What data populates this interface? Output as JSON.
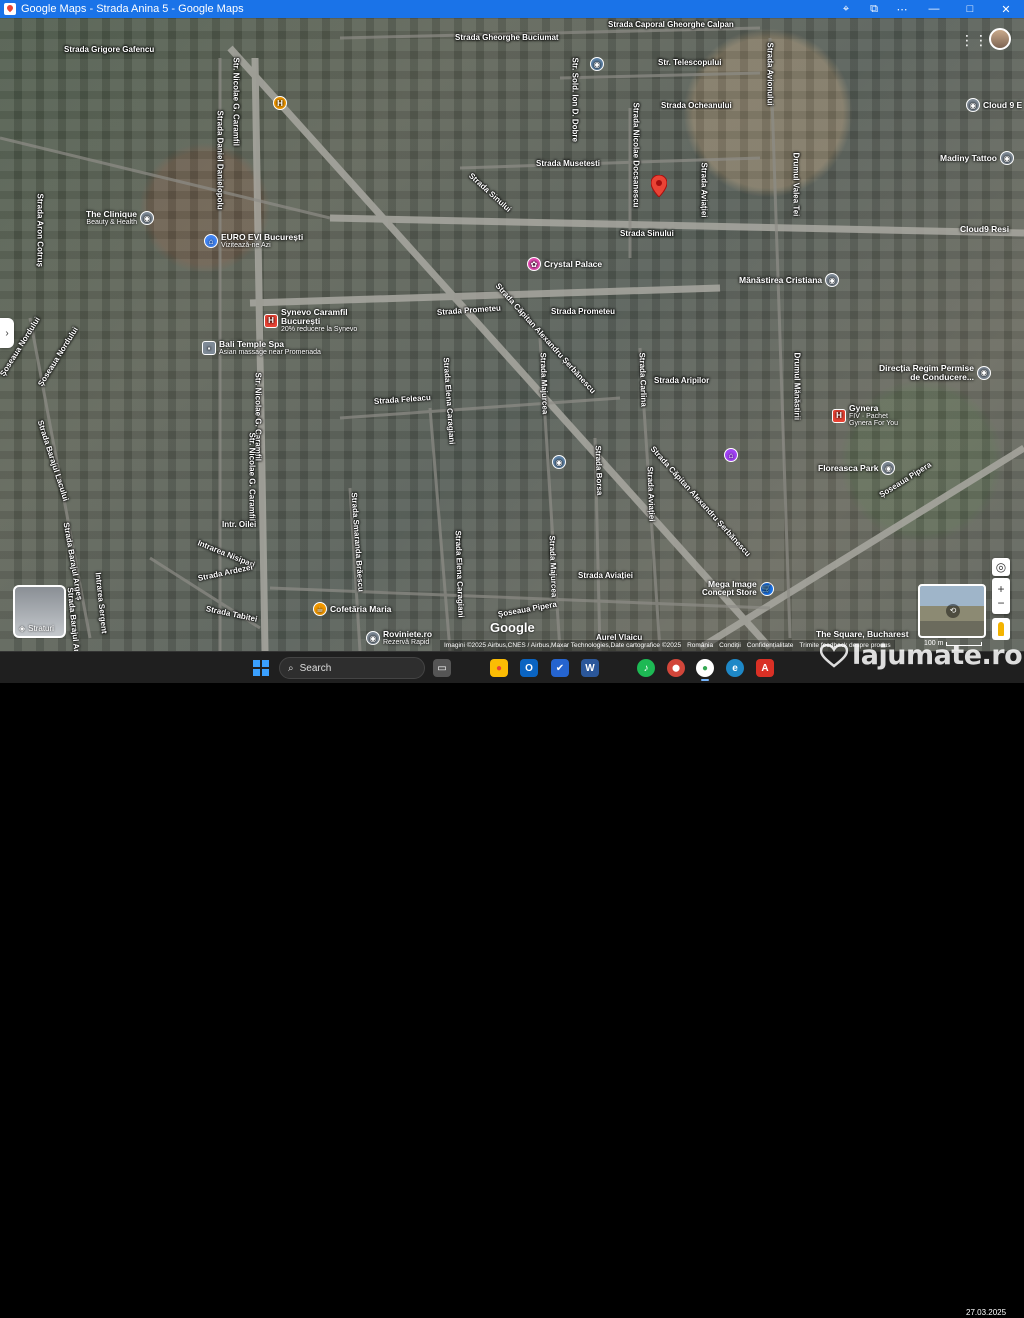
{
  "window": {
    "title": "Google Maps - Strada Anina 5 - Google Maps",
    "controls": {
      "minimize": "—",
      "maximize": "□",
      "close": "✕"
    }
  },
  "toolbar_icons": [
    "location-icon",
    "extension-icon",
    "more-icon"
  ],
  "streets": [
    {
      "id": "grigore-gafencu",
      "label": "Strada Grigore Gafencu"
    },
    {
      "id": "gheorghe-buciumat",
      "label": "Strada Gheorghe Buciumat"
    },
    {
      "id": "caporal-calpan",
      "label": "Strada Caporal Gheorghe Calpan"
    },
    {
      "id": "telescopului",
      "label": "Str. Telescopului"
    },
    {
      "id": "ocheanului",
      "label": "Strada Ocheanului"
    },
    {
      "id": "musetesti",
      "label": "Strada Musetesti"
    },
    {
      "id": "sinului-1",
      "label": "Strada Sinului"
    },
    {
      "id": "sinului-2",
      "label": "Strada Sinului"
    },
    {
      "id": "nicolae-caramfil-1",
      "label": "Str. Nicolae G. Caramfil"
    },
    {
      "id": "daniel-danielopolu",
      "label": "Strada Daniel Danielopolu"
    },
    {
      "id": "aron-cotrus",
      "label": "Strada Aron Cotruș"
    },
    {
      "id": "sold-ion-dobre",
      "label": "Str. Sold. Ion D. Dobre"
    },
    {
      "id": "nicolae-docsanescu",
      "label": "Strada Nicolae Docsanescu"
    },
    {
      "id": "avionului",
      "label": "Strada Avionului"
    },
    {
      "id": "aviatiei-1",
      "label": "Strada Aviației"
    },
    {
      "id": "drumul-valea-1",
      "label": "Drumul Valea Tei"
    },
    {
      "id": "prometeu-1",
      "label": "Strada Prometeu"
    },
    {
      "id": "prometeu-2",
      "label": "Strada Prometeu"
    },
    {
      "id": "serbanescu-1",
      "label": "Strada Căpitan Alexandru Șerbănescu"
    },
    {
      "id": "serbanescu-2",
      "label": "Strada Căpitan Alexandru Șerbănescu"
    },
    {
      "id": "majurcea-1",
      "label": "Strada Majurcea"
    },
    {
      "id": "majurcea-2",
      "label": "Strada Majurcea"
    },
    {
      "id": "elena-caragiani-1",
      "label": "Strada Elena Caragiani"
    },
    {
      "id": "elena-caragiani-2",
      "label": "Strada Elena Caragiani"
    },
    {
      "id": "feleacu",
      "label": "Strada Feleacu"
    },
    {
      "id": "aripilor",
      "label": "Strada Aripilor"
    },
    {
      "id": "carlina",
      "label": "Strada Carlina"
    },
    {
      "id": "borsa",
      "label": "Strada Borsa"
    },
    {
      "id": "aviatiei-2",
      "label": "Strada Aviației"
    },
    {
      "id": "aviatiei-3",
      "label": "Strada Aviației"
    },
    {
      "id": "smaranda-braescu",
      "label": "Strada Smaranda Brăescu"
    },
    {
      "id": "nicolae-caramfil-2",
      "label": "Str. Nicolae G. Caramfil"
    },
    {
      "id": "nicolae-caramfil-3",
      "label": "Str. Nicolae G. Caramfil"
    },
    {
      "id": "drumul-manastirii",
      "label": "Drumul Mănăstirii"
    },
    {
      "id": "soseaua-pipera-1",
      "label": "Șoseaua Pipera"
    },
    {
      "id": "soseaua-pipera-2",
      "label": "Șoseaua Pipera"
    },
    {
      "id": "soseaua-nordului",
      "label": "Șoseaua Nordului"
    },
    {
      "id": "soseaua-nordului-2",
      "label": "Șoseaua Nordului"
    },
    {
      "id": "barajul-lacului",
      "label": "Strada Barajul Lacului"
    },
    {
      "id": "barajul-arges",
      "label": "Strada Barajul Argeș"
    },
    {
      "id": "barajul-arges-2",
      "label": "Strada Barajul Argeș"
    },
    {
      "id": "intrarea-sergent",
      "label": "Intrarea Sergent"
    },
    {
      "id": "intrarea-nisipari",
      "label": "Intrarea Nisipari"
    },
    {
      "id": "strada-ardeze",
      "label": "Strada Ardezei"
    },
    {
      "id": "intrarea-orelor",
      "label": "Intr. Oilei"
    },
    {
      "id": "strada-tabita",
      "label": "Strada Tabitei"
    },
    {
      "id": "aurel-vlaicu",
      "label": "Aurel Vlaicu"
    }
  ],
  "pois": [
    {
      "id": "the-clinique",
      "name": "The Clinique",
      "sub": "Beauty & Health",
      "color": "#7e8a96",
      "icon": "◉"
    },
    {
      "id": "euro-evi",
      "name": "EURO EVI București",
      "sub": "Vizitează-ne Azi",
      "color": "#4285f4",
      "icon": "⌂"
    },
    {
      "id": "synevo",
      "name": "Synevo Caramfil București",
      "sub": "20% reducere la Synevo",
      "color": "#ea4335",
      "icon": "H"
    },
    {
      "id": "bali-temple",
      "name": "Bali Temple Spa",
      "sub": "Asian massage near Promenada",
      "color": "#7e8a96",
      "icon": "▪"
    },
    {
      "id": "crystal-palace",
      "name": "Crystal Palace",
      "sub": "",
      "color": "#e84db5",
      "icon": "✿"
    },
    {
      "id": "hospital-top",
      "name": "",
      "sub": "",
      "color": "#f29900",
      "icon": "H"
    },
    {
      "id": "gynera",
      "name": "Gynera",
      "sub": "FIV · Pachet Gynera For You",
      "color": "#ea4335",
      "icon": "H"
    },
    {
      "id": "manastirea",
      "name": "Mănăstirea Cristiana",
      "sub": "",
      "color": "#7e8a96",
      "icon": "◉"
    },
    {
      "id": "directia-regim",
      "name": "Direcția Regim Permise de Conducere...",
      "sub": "",
      "color": "#7e8a96",
      "icon": "◉"
    },
    {
      "id": "cloud9-top",
      "name": "Cloud 9 E",
      "sub": "",
      "color": "#7e8a96",
      "icon": "◉"
    },
    {
      "id": "madiny-tattoo",
      "name": "Madiny Tattoo",
      "sub": "",
      "color": "#7e8a96",
      "icon": "◉"
    },
    {
      "id": "cloud9-resi",
      "name": "Cloud9 Resi",
      "sub": "",
      "color": "#4fa3e0",
      "icon": "◉"
    },
    {
      "id": "floreasca-park",
      "name": "Floreasca Park",
      "sub": "",
      "color": "#7e8a96",
      "icon": "◉"
    },
    {
      "id": "mega-image",
      "name": "Mega Image",
      "sub": "Concept Store",
      "color": "#1a73e8",
      "icon": "🛒"
    },
    {
      "id": "the-square",
      "name": "The Square, Bucharest",
      "sub": "",
      "color": "#7e8a96",
      "icon": "◉"
    },
    {
      "id": "cofetaria-maria",
      "name": "Cofetăria Maria",
      "sub": "",
      "color": "#f29900",
      "icon": "☕"
    },
    {
      "id": "roviniete",
      "name": "Roviniete.ro",
      "sub": "Rezervă Rapid",
      "color": "#7e8a96",
      "icon": "◉"
    },
    {
      "id": "purple-poi",
      "name": "",
      "sub": "",
      "color": "#a142f4",
      "icon": "⌂"
    },
    {
      "id": "school-poi",
      "name": "",
      "sub": "",
      "color": "#5f84a8",
      "icon": "◉"
    },
    {
      "id": "top-poi",
      "name": "",
      "sub": "",
      "color": "#5f84a8",
      "icon": "◉"
    }
  ],
  "controls": {
    "layers_label": "Straturi",
    "zoom_in": "+",
    "zoom_out": "−",
    "expand": "›"
  },
  "google_logo": "Google",
  "attribution": {
    "imagery": "Imagini ©2025 Airbus,CNES / Airbus,Maxar Technologies,Date cartografice ©2025",
    "country": "România",
    "terms": "Condiții",
    "privacy": "Confidențialitate",
    "feedback": "Trimite feedback despre produs"
  },
  "scale_label": "100 m",
  "taskbar": {
    "search_placeholder": "Search",
    "apps": [
      {
        "id": "task-view",
        "glyph": "▭",
        "color": "#555"
      },
      {
        "id": "chrome",
        "glyph": "●",
        "color": "#ea4335"
      },
      {
        "id": "outlook",
        "glyph": "O",
        "color": "#0a64c2"
      },
      {
        "id": "todo",
        "glyph": "✔",
        "color": "#2564cf"
      },
      {
        "id": "word",
        "glyph": "W",
        "color": "#2b579a"
      },
      {
        "id": "spotify",
        "glyph": "♪",
        "color": "#1db954"
      },
      {
        "id": "maps",
        "glyph": "⬤",
        "color": "#d2463a"
      },
      {
        "id": "chrome-maps",
        "glyph": "●",
        "color": "#34a853"
      },
      {
        "id": "edge",
        "glyph": "e",
        "color": "#1e88c7"
      },
      {
        "id": "acrobat",
        "glyph": "A",
        "color": "#d93025"
      }
    ]
  },
  "watermark": "lajumate.ro",
  "clock": {
    "time": "",
    "date": "27.03.2025"
  }
}
